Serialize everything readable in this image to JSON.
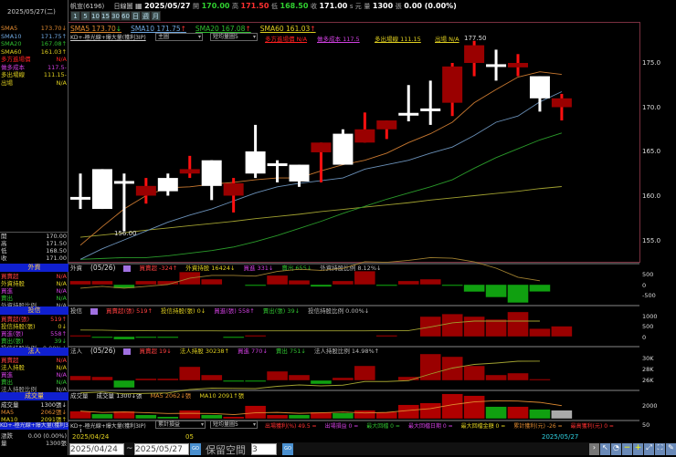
{
  "header": {
    "stock": "帆宣(6196)",
    "chart_type": "日線圖",
    "date": "2025/05/27",
    "open_label": "開",
    "open": "170.00",
    "high_label": "高",
    "high": "171.50",
    "low_label": "低",
    "low": "168.50",
    "close_label": "收",
    "close": "171.00",
    "unit": "s 元",
    "vol_label": "量",
    "vol": "1300",
    "vol_unit": "張",
    "change": "0.00 (0.00%)"
  },
  "period_buttons": [
    "1",
    "5",
    "10",
    "15",
    "30",
    "60",
    "日",
    "週",
    "月"
  ],
  "ma_legend": [
    {
      "label": "SMA5 173.70",
      "arrow": "↓",
      "color": "#e08a30"
    },
    {
      "label": "SMA10 171.75",
      "arrow": "↑",
      "color": "#70a8e0"
    },
    {
      "label": "SMA20 167.08",
      "arrow": "↑",
      "color": "#30c030"
    },
    {
      "label": "SMA60 161.03",
      "arrow": "↑",
      "color": "#e0d020"
    }
  ],
  "strategy": {
    "name": "KD+-極光線+爆大量(獲利3IP)",
    "main_select": "主圖",
    "ma_select": "短均量圖5",
    "entry": "多方進場價 N/A",
    "cost": "做多成本 117.5",
    "exit_line": "多出場線 111.15",
    "exit": "出場 N/A"
  },
  "left": {
    "date": "2025/05/27(二)",
    "ma_rows": [
      {
        "label": "SMA5",
        "value": "173.70↓",
        "color": "#e08a30"
      },
      {
        "label": "SMA10",
        "value": "171.75↑",
        "color": "#70a8e0"
      },
      {
        "label": "SMA20",
        "value": "167.08↑",
        "color": "#30c030"
      },
      {
        "label": "SMA60",
        "value": "161.03↑",
        "color": "#e0d020"
      },
      {
        "label": "多方進場價",
        "value": "N/A",
        "color": "#ff2020"
      },
      {
        "label": "做多成本",
        "value": "117.5-",
        "color": "#d040e0"
      },
      {
        "label": "多出場線",
        "value": "111.15-",
        "color": "#e0d020"
      },
      {
        "label": "出場",
        "value": "N/A",
        "color": "#e0d020"
      }
    ],
    "ohlc": [
      {
        "label": "開",
        "value": "170.00"
      },
      {
        "label": "高",
        "value": "171.50"
      },
      {
        "label": "低",
        "value": "168.50"
      },
      {
        "label": "收",
        "value": "171.00"
      }
    ],
    "sections": [
      {
        "title": "外資",
        "rows": [
          {
            "label": "買賣超",
            "value": "N/A",
            "color": "#ff4040"
          },
          {
            "label": "外資持股",
            "value": "N/A",
            "color": "#e0d020"
          },
          {
            "label": "買進",
            "value": "N/A",
            "color": "#d040e0"
          },
          {
            "label": "賣出",
            "value": "N/A",
            "color": "#30c030"
          },
          {
            "label": "外資持股比例",
            "value": "N/A",
            "color": "#aaa"
          }
        ]
      },
      {
        "title": "投信",
        "rows": [
          {
            "label": "買賣超(張)",
            "value": "519↑",
            "color": "#ff4040"
          },
          {
            "label": "投信持股(張)",
            "value": "0↓",
            "color": "#e0d020"
          },
          {
            "label": "買進(張)",
            "value": "558↑",
            "color": "#d040e0"
          },
          {
            "label": "賣出(張)",
            "value": "39↓",
            "color": "#30c030"
          },
          {
            "label": "投信持股比例",
            "value": "0.00%↓",
            "color": "#aaa"
          }
        ]
      },
      {
        "title": "法人",
        "rows": [
          {
            "label": "買賣超",
            "value": "N/A",
            "color": "#ff4040"
          },
          {
            "label": "法人持股",
            "value": "N/A",
            "color": "#e0d020"
          },
          {
            "label": "買進",
            "value": "N/A",
            "color": "#d040e0"
          },
          {
            "label": "賣出",
            "value": "N/A",
            "color": "#30c030"
          },
          {
            "label": "法人持股比例",
            "value": "N/A",
            "color": "#aaa"
          }
        ]
      },
      {
        "title": "成交量",
        "rows": [
          {
            "label": "成交量",
            "value": "1300張↓",
            "color": "#ddd"
          },
          {
            "label": "MA5",
            "value": "2062張↓",
            "color": "#e08a30"
          },
          {
            "label": "MA10",
            "value": "2091張↑",
            "color": "#e0d020"
          }
        ]
      }
    ],
    "strategy_label": "KD+-極光線+爆大量(獲利3IP)",
    "change_label": "漲跌",
    "change_value": "0.00 (0.00%)",
    "vol_label": "量",
    "vol_value": "1300張"
  },
  "panels": {
    "foreign": {
      "title": "外資",
      "date": "(05/26)",
      "items": [
        {
          "t": "買賣超 -324↑",
          "c": "#ff4040"
        },
        {
          "t": "外資持股 16424↓",
          "c": "#e0d020"
        },
        {
          "t": "買進 331↓",
          "c": "#d040e0"
        },
        {
          "t": "賣出 655↓",
          "c": "#30c030"
        },
        {
          "t": "外資持股比例 8.12%↓",
          "c": "#bbb"
        }
      ],
      "axis": [
        "500",
        "0",
        "-500"
      ]
    },
    "trust": {
      "title": "投信",
      "items": [
        {
          "t": "買賣超(張) 519↑",
          "c": "#ff4040"
        },
        {
          "t": "投信持股(張) 0↓",
          "c": "#e0d020"
        },
        {
          "t": "買進(張) 558↑",
          "c": "#d040e0"
        },
        {
          "t": "賣出(張) 39↓",
          "c": "#30c030"
        },
        {
          "t": "投信持股比例 0.00%↓",
          "c": "#bbb"
        }
      ],
      "axis": [
        "1000",
        "500",
        "0"
      ]
    },
    "inst": {
      "title": "法人",
      "date": "(05/26)",
      "items": [
        {
          "t": "買賣超 19↓",
          "c": "#ff4040"
        },
        {
          "t": "法人持股 30238↑",
          "c": "#e0d020"
        },
        {
          "t": "買進 770↓",
          "c": "#d040e0"
        },
        {
          "t": "賣出 751↓",
          "c": "#30c030"
        },
        {
          "t": "法人持股比例 14.98%↑",
          "c": "#bbb"
        }
      ],
      "axis": [
        "30K",
        "28K",
        "26K"
      ]
    },
    "volume": {
      "title": "成交量",
      "items": [
        {
          "t": "成交量 1300↓張",
          "c": "#ddd"
        },
        {
          "t": "MA5 2062↓張",
          "c": "#e08a30"
        },
        {
          "t": "MA10 2091↑張",
          "c": "#e0d020"
        }
      ],
      "axis": [
        "2000",
        "50"
      ]
    }
  },
  "bottom": {
    "select1": "累計損益",
    "select2": "短均量圖5",
    "metrics": [
      {
        "t": "出場獲利(%) 49.5 =",
        "c": "#ff3030"
      },
      {
        "t": "出場損益 0 =",
        "c": "#d040e0"
      },
      {
        "t": "最大回檔 0 =",
        "c": "#30c030"
      },
      {
        "t": "最大回檔日期 0 =",
        "c": "#d040e0"
      },
      {
        "t": "最大回檔金額 0 =",
        "c": "#e0d020"
      },
      {
        "t": "累計獲利(元) -26 =",
        "c": "#e08a30"
      },
      {
        "t": "最高獲利(元) 0 =",
        "c": "#ff3030"
      }
    ],
    "date_start": "2025/04/24",
    "date_mid": "05",
    "date_end": "2025/05/27",
    "from": "2025/04/24",
    "to": "2025/05/27",
    "go": "GO",
    "keep_label": "保留空間",
    "keep_value": "3"
  },
  "chart_data": {
    "type": "candlestick",
    "price_axis": [
      "175.0",
      "170.0",
      "165.0",
      "160.0",
      "155.0"
    ],
    "ylim": [
      152.5,
      178.5
    ],
    "annotations": {
      "high": "177.50",
      "low": "156.00"
    },
    "candles": [
      [
        159.7,
        162.5,
        158.5,
        159.7
      ],
      [
        163,
        163,
        158.5,
        158.5
      ],
      [
        161.5,
        162.5,
        156,
        161.5
      ],
      [
        160,
        162,
        159.1,
        161.1
      ],
      [
        162,
        162.5,
        160,
        160.5
      ],
      [
        162.5,
        164.5,
        162,
        163
      ],
      [
        164,
        164,
        159.5,
        161.1
      ],
      [
        160,
        162,
        158.1,
        161.4
      ],
      [
        165,
        168,
        162,
        162.5
      ],
      [
        163.5,
        164,
        161.5,
        163.5
      ],
      [
        163.5,
        163.5,
        161,
        161.6
      ],
      [
        164.9,
        166,
        161.5,
        166
      ],
      [
        167,
        167.5,
        163.5,
        163.5
      ],
      [
        166,
        169.4,
        166,
        167.5
      ],
      [
        167.5,
        168.5,
        166.4,
        168.5
      ],
      [
        169.2,
        172.5,
        168.4,
        169.2
      ],
      [
        169.7,
        173,
        168,
        169.7
      ],
      [
        170.5,
        175,
        169,
        174.6
      ],
      [
        175,
        177.5,
        173.5,
        177
      ],
      [
        174.7,
        176.5,
        173,
        174.7
      ],
      [
        174.5,
        176,
        173.5,
        175
      ],
      [
        173.5,
        173.5,
        169.5,
        171
      ],
      [
        170,
        171.5,
        168.5,
        171
      ]
    ],
    "sma5": [
      154.4,
      156.5,
      158.5,
      160,
      160.9,
      161,
      161.3,
      161.5,
      161.8,
      162,
      162,
      162.8,
      163.5,
      164,
      164.8,
      166,
      167,
      168.3,
      170.5,
      172,
      173.4,
      174,
      173.7
    ],
    "sma10": [
      152.8,
      154,
      155,
      156,
      157,
      157.8,
      158.5,
      159.4,
      160.3,
      161,
      161.4,
      161.7,
      162,
      163,
      163.5,
      164,
      164.8,
      165.5,
      166.8,
      168.3,
      169,
      170.6,
      171.75
    ],
    "sma20": [
      152.8,
      152.9,
      153,
      153,
      153.2,
      153.5,
      153.8,
      154.2,
      154.8,
      155.5,
      156.3,
      157.1,
      158,
      158.8,
      159.6,
      160.3,
      161,
      161.8,
      163.1,
      164.3,
      165.3,
      166.3,
      167.08
    ],
    "sma60": [
      155.3,
      155.55,
      155.8,
      156.1,
      156.35,
      156.6,
      156.85,
      157.1,
      157.4,
      157.65,
      157.9,
      158.2,
      158.45,
      158.7,
      158.95,
      159.2,
      159.5,
      159.75,
      160,
      160.25,
      160.5,
      160.8,
      161.03
    ],
    "foreign_net": [
      170,
      170,
      -170,
      170,
      170,
      580,
      250,
      0,
      -60,
      420,
      200,
      -100,
      170,
      620,
      -50,
      170,
      250,
      -50,
      -330,
      -580,
      -830,
      -324,
      null
    ],
    "trust_net": [
      50,
      -30,
      -140,
      -30,
      -30,
      0,
      0,
      -30,
      50,
      0,
      0,
      0,
      0,
      0,
      50,
      0,
      1000,
      1130,
      1000,
      860,
      1230,
      400,
      519
    ],
    "inst_net": [
      500,
      400,
      -800,
      200,
      200,
      1500,
      600,
      -100,
      -100,
      1000,
      600,
      -400,
      300,
      1600,
      0,
      400,
      2900,
      2600,
      1600,
      600,
      800,
      19,
      null
    ],
    "volume": [
      1160,
      740,
      1160,
      600,
      320,
      1300,
      600,
      320,
      2000,
      600,
      600,
      1020,
      880,
      1300,
      1020,
      2140,
      2420,
      3820,
      3540,
      1860,
      1860,
      1440,
      1300
    ],
    "volume_dir": [
      "u",
      "d",
      "u",
      "d",
      "d",
      "u",
      "d",
      "u",
      "u",
      "u",
      "d",
      "u",
      "d",
      "u",
      "u",
      "u",
      "u",
      "u",
      "u",
      "d",
      "u",
      "d",
      "t"
    ]
  }
}
